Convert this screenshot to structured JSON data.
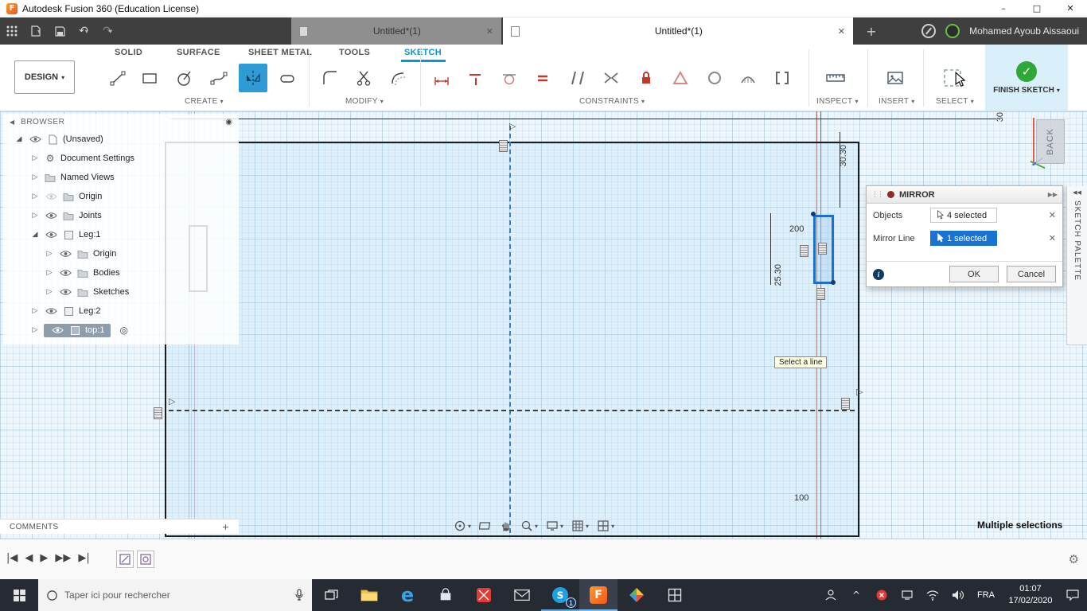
{
  "titlebar": {
    "title": "Autodesk Fusion 360 (Education License)"
  },
  "tabstrip": {
    "tabs": [
      {
        "label": "Untitled*(1)"
      },
      {
        "label": "Untitled*(1)"
      }
    ],
    "username": "Mohamed Ayoub Aissaoui"
  },
  "ribbon": {
    "design": "DESIGN",
    "tabs": [
      "SOLID",
      "SURFACE",
      "SHEET METAL",
      "TOOLS",
      "SKETCH"
    ],
    "active_tab": "SKETCH",
    "groups": [
      "CREATE",
      "MODIFY",
      "CONSTRAINTS",
      "INSPECT",
      "INSERT",
      "SELECT"
    ],
    "finish": "FINISH SKETCH"
  },
  "browser": {
    "title": "BROWSER",
    "items": [
      {
        "label": "(Unsaved)"
      },
      {
        "label": "Document Settings"
      },
      {
        "label": "Named Views"
      },
      {
        "label": "Origin"
      },
      {
        "label": "Joints"
      },
      {
        "label": "Leg:1"
      },
      {
        "label": "Origin"
      },
      {
        "label": "Bodies"
      },
      {
        "label": "Sketches"
      },
      {
        "label": "Leg:2"
      },
      {
        "label": "top:1"
      }
    ]
  },
  "comments": {
    "label": "COMMENTS"
  },
  "canvas": {
    "dims": {
      "d1": "200",
      "d2": "25.30",
      "d3": "30.30",
      "d4": "100",
      "d5": "30"
    },
    "tooltip": "Select a line",
    "viewcube": "BACK",
    "status": "Multiple selections"
  },
  "palette": {
    "label": "SKETCH PALETTE"
  },
  "dialog": {
    "title": "MIRROR",
    "objects_label": "Objects",
    "objects_value": "4 selected",
    "mirrorline_label": "Mirror Line",
    "mirrorline_value": "1 selected",
    "ok": "OK",
    "cancel": "Cancel"
  },
  "taskbar": {
    "search": "Taper ici pour rechercher",
    "lang": "FRA",
    "time": "01:07",
    "date": "17/02/2020",
    "badge": "1"
  },
  "colors": {
    "accent_blue": "#0696d7",
    "selection_blue": "#1873d3",
    "finish_green": "#2ea836",
    "fusion_orange": "#f0561d"
  },
  "icons": {
    "caret": "▾",
    "close": "✕",
    "minimize": "–",
    "maximize": "□",
    "undo": "↶",
    "redo": "↷",
    "plus": "+",
    "back_arrow": "◀",
    "collapse": "◀◀",
    "expand": "▶▶",
    "panel_dot": "◉",
    "target": "◎",
    "gear": "⚙",
    "info": "i",
    "grip": "⋮⋮",
    "tri_closed": "▷",
    "tri_open": "◢",
    "skip_start": "|◀",
    "step_back": "◀",
    "play": "▶",
    "fast_forward": "▶▶",
    "skip_end": "▶|",
    "chevron_up": "^",
    "check": "✓"
  }
}
